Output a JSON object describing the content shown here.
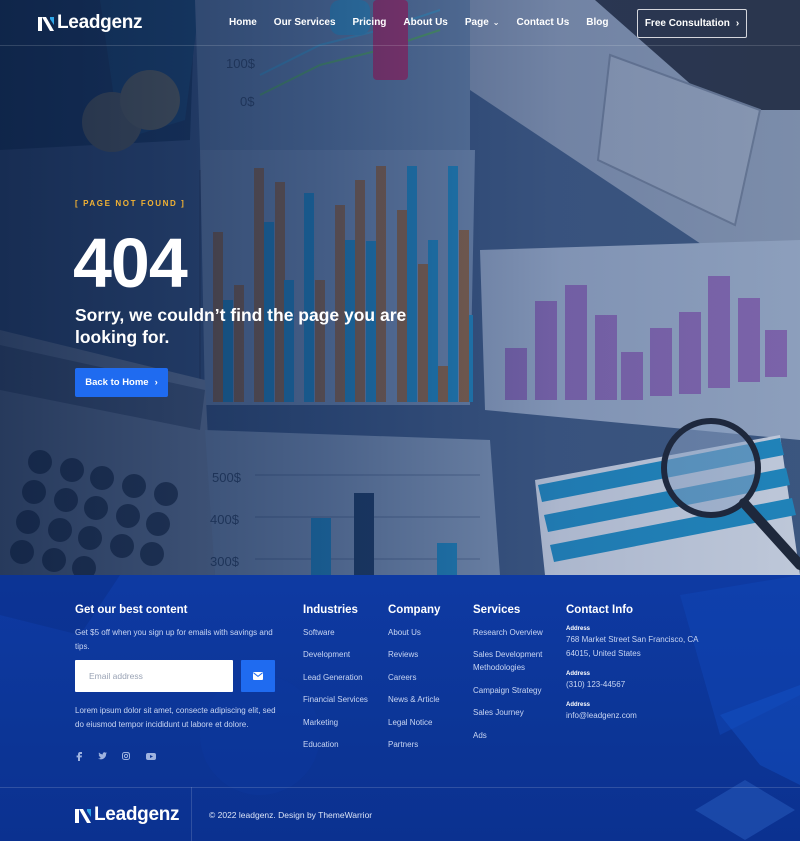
{
  "brand": {
    "name": "Leadgenz",
    "accent": "#1f6bf0",
    "eyebrow_color": "#f2b233"
  },
  "nav": {
    "items": [
      {
        "label": "Home"
      },
      {
        "label": "Our Services"
      },
      {
        "label": "Pricing"
      },
      {
        "label": "About Us"
      },
      {
        "label": "Page",
        "has_dropdown": true
      },
      {
        "label": "Contact Us"
      },
      {
        "label": "Blog"
      }
    ],
    "cta_label": "Free Consultation"
  },
  "hero": {
    "eyebrow": "[ PAGE NOT FOUND ]",
    "code": "404",
    "message": "Sorry, we couldn’t find the page you are looking for.",
    "button_label": "Back to Home",
    "background_axis_labels": [
      "100$",
      "0$",
      "500$",
      "400$",
      "300$"
    ]
  },
  "footer": {
    "newsletter": {
      "title": "Get our best content",
      "text": "Get $5 off when you sign up for emails with savings and tips.",
      "email_placeholder": "Email address",
      "submit_icon": "envelope-icon",
      "about": "Lorem ipsum dolor sit amet, consecte adipiscing elit, sed do eiusmod tempor incididunt ut labore et dolore."
    },
    "social": [
      "facebook-icon",
      "twitter-icon",
      "instagram-icon",
      "youtube-icon"
    ],
    "industries": {
      "title": "Industries",
      "links": [
        "Software",
        "Development",
        "Lead Generation",
        "Financial Services",
        "Marketing",
        "Education"
      ]
    },
    "company": {
      "title": "Company",
      "links": [
        "About Us",
        "Reviews",
        "Careers",
        "News & Article",
        "Legal Notice",
        "Partners"
      ]
    },
    "services": {
      "title": "Services",
      "links": [
        "Research Overview",
        "Sales Development Methodologies",
        "Campaign Strategy",
        "Sales Journey",
        "Ads"
      ]
    },
    "contact": {
      "title": "Contact Info",
      "address_label": "Address",
      "address": "768 Market Street San Francisco, CA 64015, United States",
      "phone_label": "Address",
      "phone": "(310) 123-44567",
      "email_label": "Address",
      "email": "info@leadgenz.com"
    },
    "copyright": "© 2022 leadgenz. Design by ThemeWarrior"
  }
}
